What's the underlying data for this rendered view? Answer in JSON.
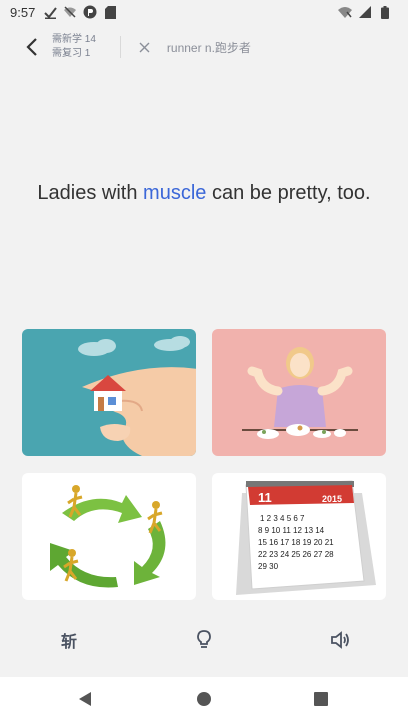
{
  "status": {
    "time": "9:57"
  },
  "header": {
    "new_label": "需新学 14",
    "review_label": "需复习 1",
    "word": "runner n.跑步者"
  },
  "sentence": {
    "before": "Ladies with ",
    "highlight": "muscle",
    "after": " can be pretty, too."
  },
  "cards": [
    {
      "icon": "house-in-hand-image"
    },
    {
      "icon": "strong-woman-image"
    },
    {
      "icon": "recycle-people-image"
    },
    {
      "icon": "calendar-image",
      "calendar_month": "11",
      "calendar_year": "2015",
      "calendar_rows": [
        "1 2 3 4 5 6 7",
        "8 9 10 11 12 13 14",
        "15 16 17 18 19 20 21",
        "22 23 24 25 26 27 28",
        "29 30"
      ]
    }
  ],
  "toolbar": {
    "chop_label": "斩",
    "hint_icon": "lightbulb-icon",
    "sound_icon": "speaker-icon"
  },
  "colors": {
    "accent": "#3b67d8",
    "card1": "#4aa5b0",
    "card2": "#f1b2ad"
  }
}
